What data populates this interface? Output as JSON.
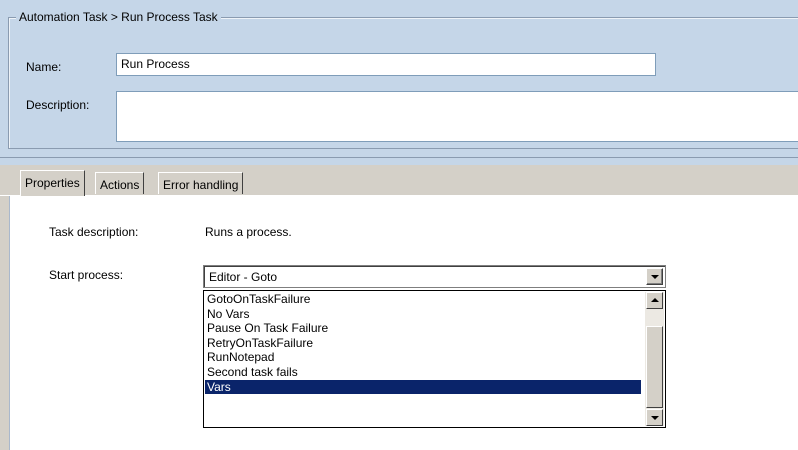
{
  "header": {
    "group_title": "Automation Task > Run Process Task",
    "name_label": "Name:",
    "name_value": "Run Process",
    "description_label": "Description:",
    "description_value": ""
  },
  "tabs": [
    {
      "label": "Properties",
      "active": true
    },
    {
      "label": "Actions",
      "active": false
    },
    {
      "label": "Error handling",
      "active": false
    }
  ],
  "properties": {
    "task_description_label": "Task description:",
    "task_description_value": "Runs a process.",
    "start_process_label": "Start process:",
    "start_process_selected": "Editor - Goto",
    "dropdown_options": [
      "GotoOnTaskFailure",
      "No Vars",
      "Pause On Task Failure",
      "RetryOnTaskFailure",
      "RunNotepad",
      "Second task fails",
      "Vars"
    ],
    "highlighted_option": "Vars"
  },
  "colors": {
    "header_background": "#c5d6e8",
    "selection": "#0a246a",
    "face": "#d4d0c8"
  }
}
